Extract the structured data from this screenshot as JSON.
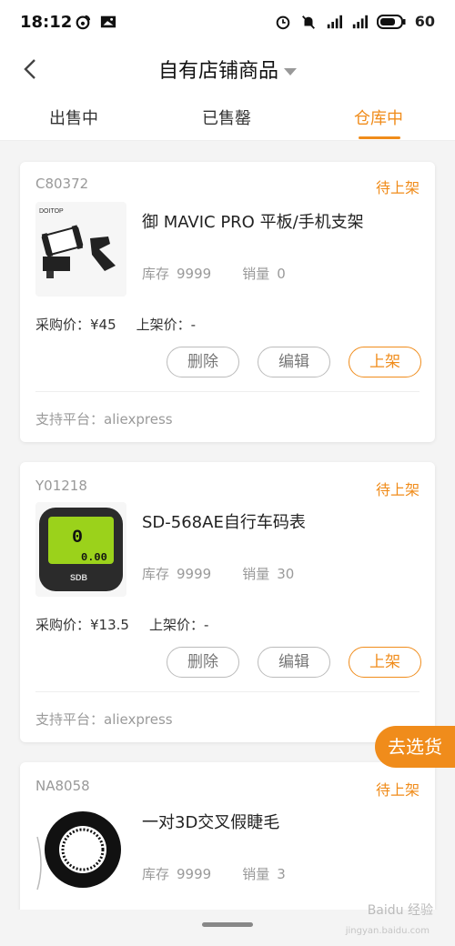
{
  "status_bar": {
    "time": "18:12",
    "battery": "60",
    "icons": [
      "weibo-icon",
      "gallery-icon",
      "alarm-icon",
      "mute-icon",
      "signal-icon",
      "signal-4g-icon",
      "battery-icon"
    ]
  },
  "header": {
    "title": "自有店铺商品"
  },
  "tabs": [
    {
      "label": "出售中",
      "active": false
    },
    {
      "label": "已售罄",
      "active": false
    },
    {
      "label": "仓库中",
      "active": true
    }
  ],
  "labels": {
    "stock": "库存",
    "sales": "销量",
    "purchase_price": "采购价：",
    "listing_price": "上架价：",
    "delete": "删除",
    "edit": "编辑",
    "list_up": "上架",
    "platform_prefix": "支持平台："
  },
  "products": [
    {
      "code": "C80372",
      "status": "待上架",
      "name": "御 MAVIC PRO 平板/手机支架",
      "stock": "9999",
      "sales": "0",
      "purchase_price": "¥45",
      "listing_price": "-",
      "platform": "aliexpress",
      "image": "tablet-holder",
      "brand_text": "DOITOP"
    },
    {
      "code": "Y01218",
      "status": "待上架",
      "name": "SD-568AE自行车码表",
      "stock": "9999",
      "sales": "30",
      "purchase_price": "¥13.5",
      "listing_price": "-",
      "platform": "aliexpress",
      "image": "bike-computer",
      "brand_text": "SDB"
    },
    {
      "code": "NA8058",
      "status": "待上架",
      "name": "一对3D交叉假睫毛",
      "stock": "9999",
      "sales": "3",
      "image": "eyelashes"
    }
  ],
  "float_button": "去选货",
  "watermark": {
    "main": "Baidu 经验",
    "sub": "jingyan.baidu.com"
  }
}
